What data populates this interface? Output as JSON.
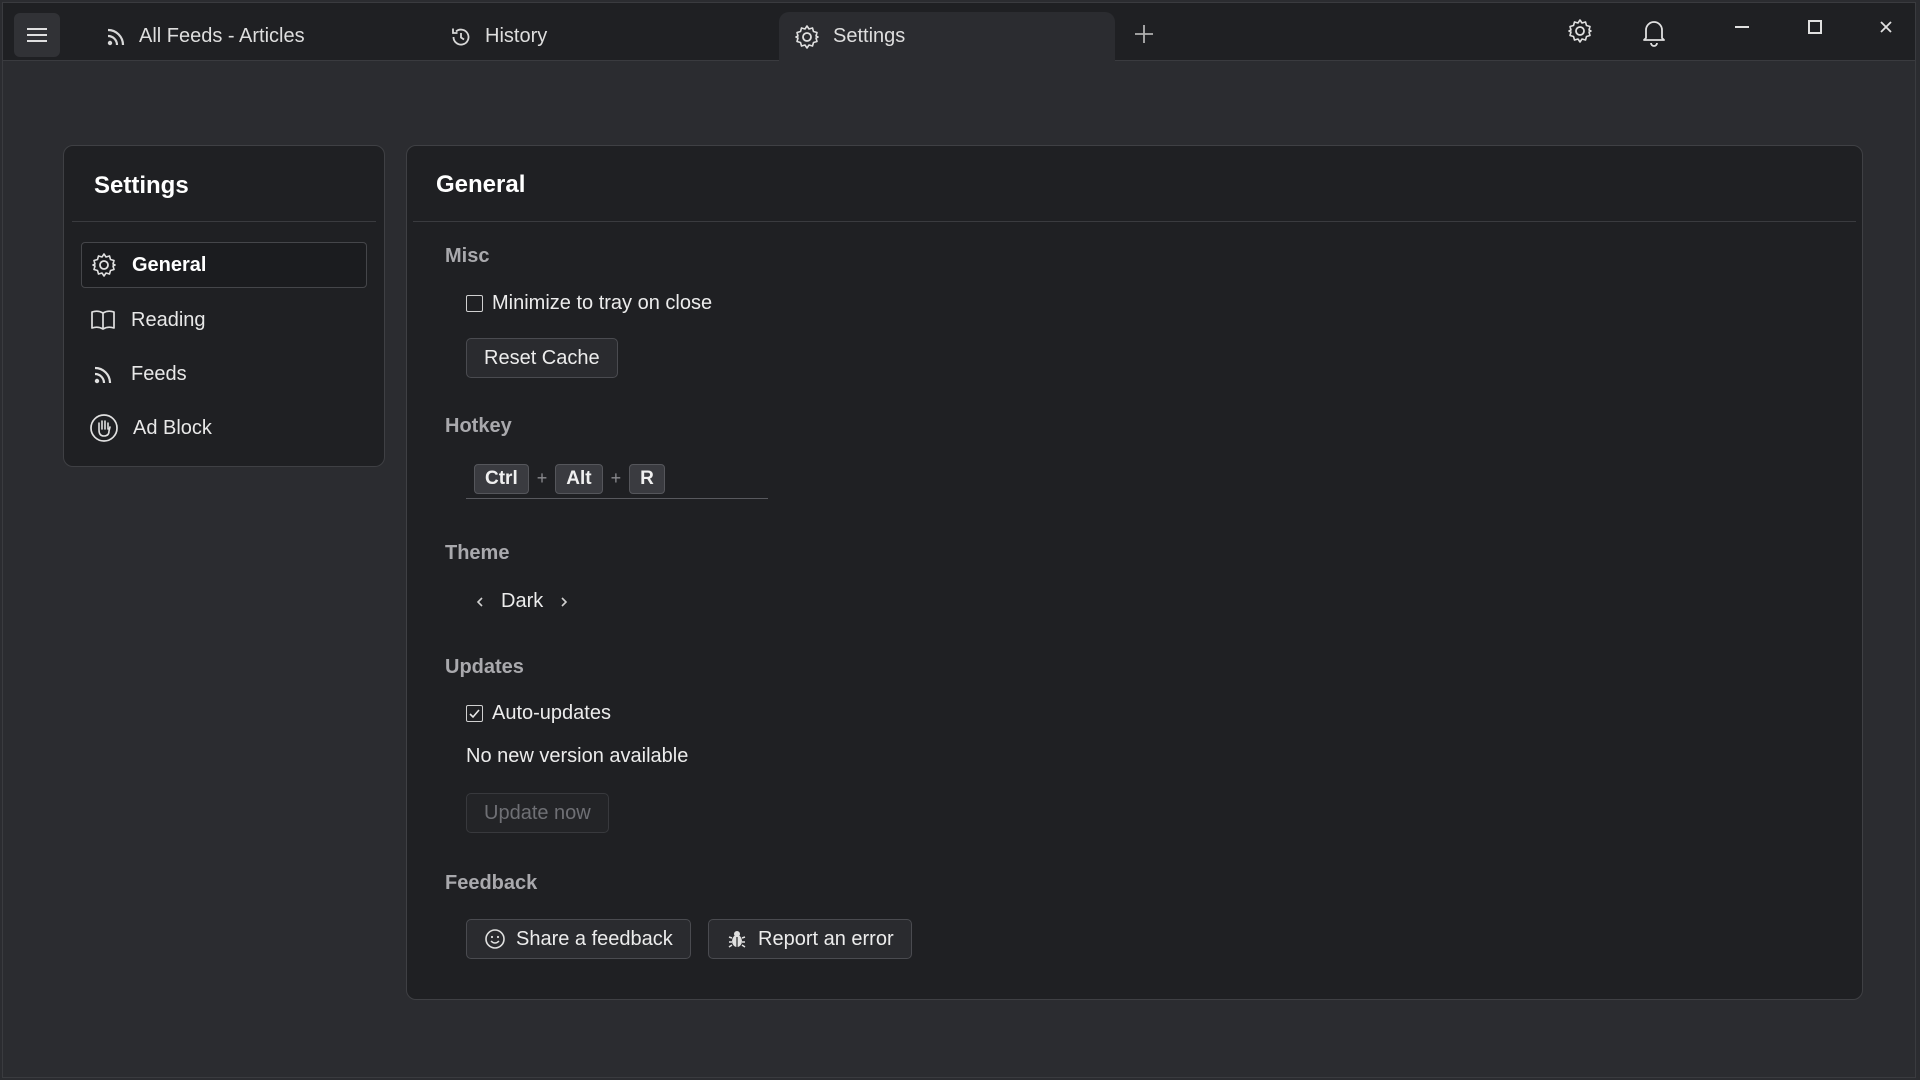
{
  "titlebar": {
    "tabs": [
      {
        "label": "All Feeds - Articles",
        "icon": "rss-icon"
      },
      {
        "label": "History",
        "icon": "history-icon"
      },
      {
        "label": "Settings",
        "icon": "gear-icon",
        "active": true
      }
    ],
    "icons": [
      "menu-icon",
      "plus-icon",
      "gear-icon",
      "bell-icon",
      "minimize-icon",
      "maximize-icon",
      "close-icon"
    ]
  },
  "sidebar": {
    "title": "Settings",
    "items": [
      {
        "label": "General",
        "icon": "gear-icon",
        "active": true
      },
      {
        "label": "Reading",
        "icon": "book-icon"
      },
      {
        "label": "Feeds",
        "icon": "rss-icon"
      },
      {
        "label": "Ad Block",
        "icon": "hand-stop-icon"
      }
    ]
  },
  "main": {
    "title": "General",
    "misc": {
      "heading": "Misc",
      "minimize_label": "Minimize to tray on close",
      "minimize_checked": false,
      "reset_cache_label": "Reset Cache"
    },
    "hotkey": {
      "heading": "Hotkey",
      "keys": [
        "Ctrl",
        "Alt",
        "R"
      ],
      "separator": "+"
    },
    "theme": {
      "heading": "Theme",
      "value": "Dark"
    },
    "updates": {
      "heading": "Updates",
      "auto_label": "Auto-updates",
      "auto_checked": true,
      "status": "No new version available",
      "update_now_label": "Update now"
    },
    "feedback": {
      "heading": "Feedback",
      "share_label": "Share a feedback",
      "report_label": "Report an error"
    }
  },
  "colors": {
    "background": "#2b2c30",
    "panel": "#1f2023",
    "border": "#3f4044",
    "heading_muted": "#a9a9ad",
    "text": "#e6e6e6"
  }
}
